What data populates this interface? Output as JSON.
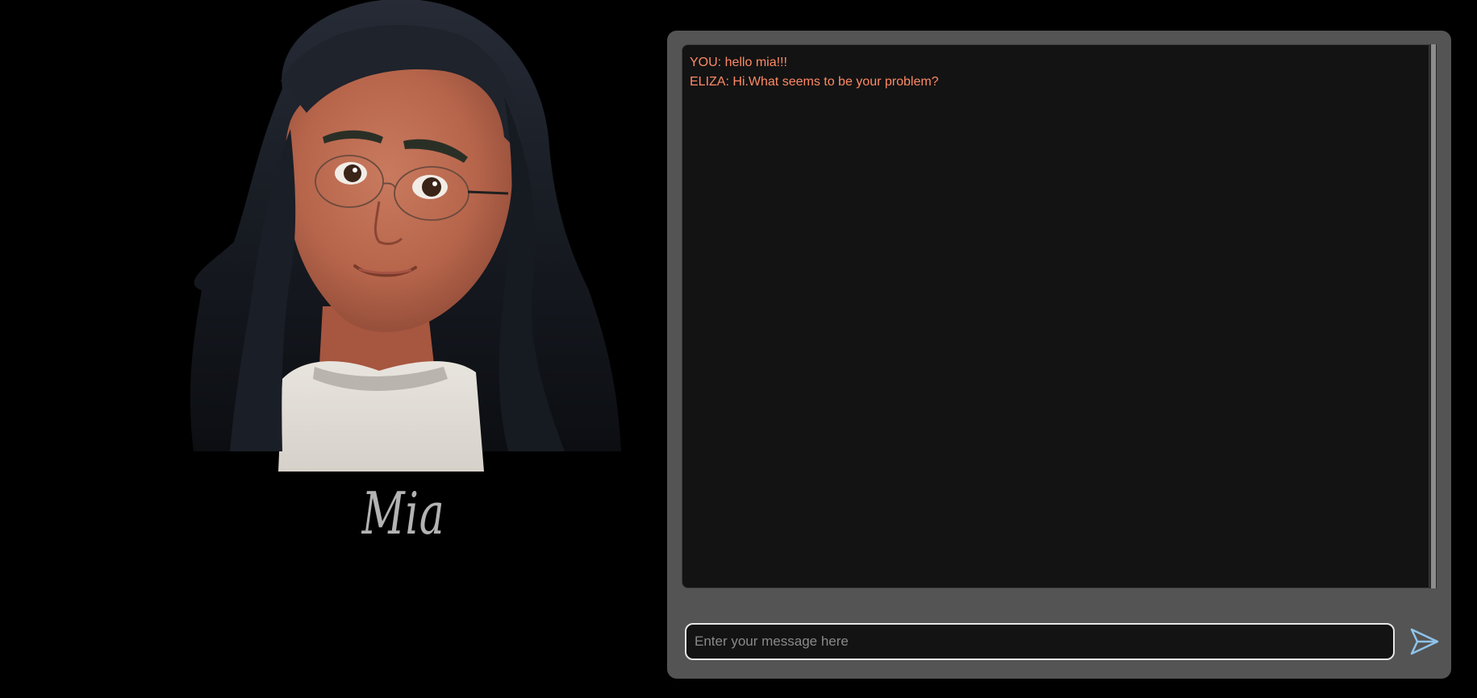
{
  "character": {
    "name": "Mia"
  },
  "chat": {
    "messages": [
      {
        "text": "YOU: hello mia!!!"
      },
      {
        "text": "ELIZA: Hi.What seems to be your problem?"
      }
    ],
    "message_color": "#ff8a65"
  },
  "composer": {
    "placeholder": "Enter your message here",
    "value": ""
  },
  "icons": {
    "send": "send-icon"
  },
  "colors": {
    "page_background": "#000000",
    "panel_background": "#545454",
    "log_background": "#131313",
    "send_icon": "#8fc3ea"
  }
}
